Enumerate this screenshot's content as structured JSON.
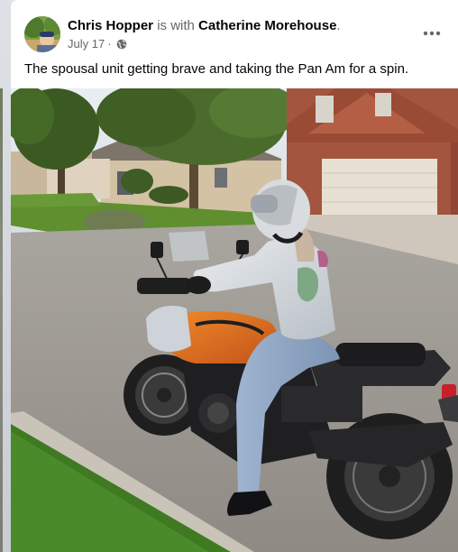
{
  "post": {
    "author_name": "Chris Hopper",
    "with_text": "is with",
    "tagged_name": "Catherine Morehouse",
    "trailing_period": ".",
    "date": "July 17",
    "separator": "·",
    "privacy_icon": "globe-icon",
    "more_icon": "more-options-icon",
    "text": "The spousal unit getting brave and taking the Pan Am for a spin."
  },
  "photo": {
    "subject": "motorcycle-photo"
  },
  "colors": {
    "card_bg": "#ffffff",
    "page_bg": "#e4e6eb",
    "primary_text": "#050505",
    "secondary_text": "#65676b"
  }
}
